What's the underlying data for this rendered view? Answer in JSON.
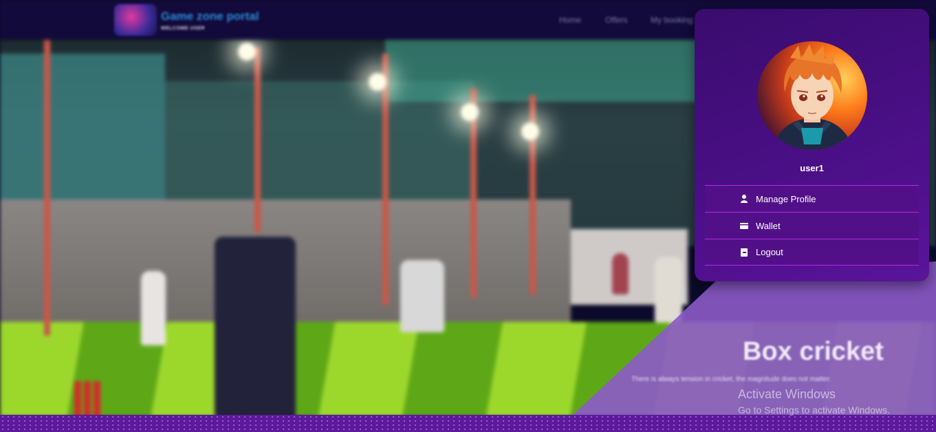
{
  "header": {
    "brand_title": "Game zone portal",
    "brand_subtitle": "WELCOME USER",
    "nav": [
      "Home",
      "Offers",
      "My booking"
    ]
  },
  "hero": {
    "title": "Box cricket",
    "text": "There is always tension in cricket, the magnitude does not matter."
  },
  "profile_menu": {
    "username": "user1",
    "items": [
      {
        "label": "Manage Profile",
        "icon": "user-icon"
      },
      {
        "label": "Wallet",
        "icon": "wallet-icon"
      },
      {
        "label": "Logout",
        "icon": "logout-icon"
      }
    ]
  },
  "watermark": {
    "line1": "Activate Windows",
    "line2": "Go to Settings to activate Windows."
  },
  "colors": {
    "dropdown_bg": "#4a0f86",
    "menu_border": "#b326e8",
    "header_bg": "#120a3a"
  }
}
